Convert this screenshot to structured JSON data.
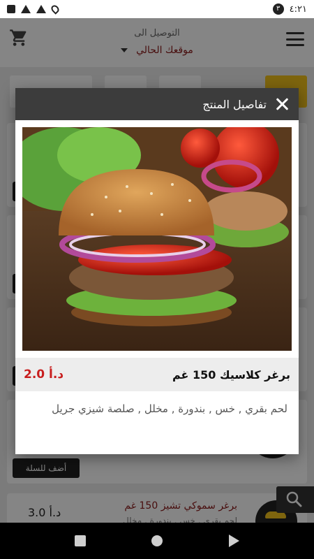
{
  "status_bar": {
    "time": "٤:٢١",
    "notification_badge": "٣"
  },
  "app_header": {
    "deliver_to_label": "التوصيل الى",
    "location_value": "موقعك الحالي"
  },
  "dialog": {
    "title": "تفاصيل المنتج",
    "product_name": "برغر كلاسيك 150 غم",
    "price": "2.0 د.أ",
    "description": "لحم بقري , خس , بندورة , مخلل , صلصة شيزي جريل"
  },
  "background_list": {
    "add_to_cart_label": "أضف للسلة",
    "item_name": "برغر سموكي تشيز 150 غم",
    "item_desc": "لحم بقري , خس , بندورة , مخلل",
    "item_price": "3.0 د.أ"
  },
  "colors": {
    "accent": "#f2c21b",
    "header": "#3c3c3c",
    "price": "#c81e1e",
    "location": "#8a1a1a"
  },
  "icons": [
    "cart-icon",
    "menu-icon",
    "close-icon",
    "search-icon",
    "nav-back-icon",
    "nav-home-icon",
    "nav-recents-icon"
  ]
}
